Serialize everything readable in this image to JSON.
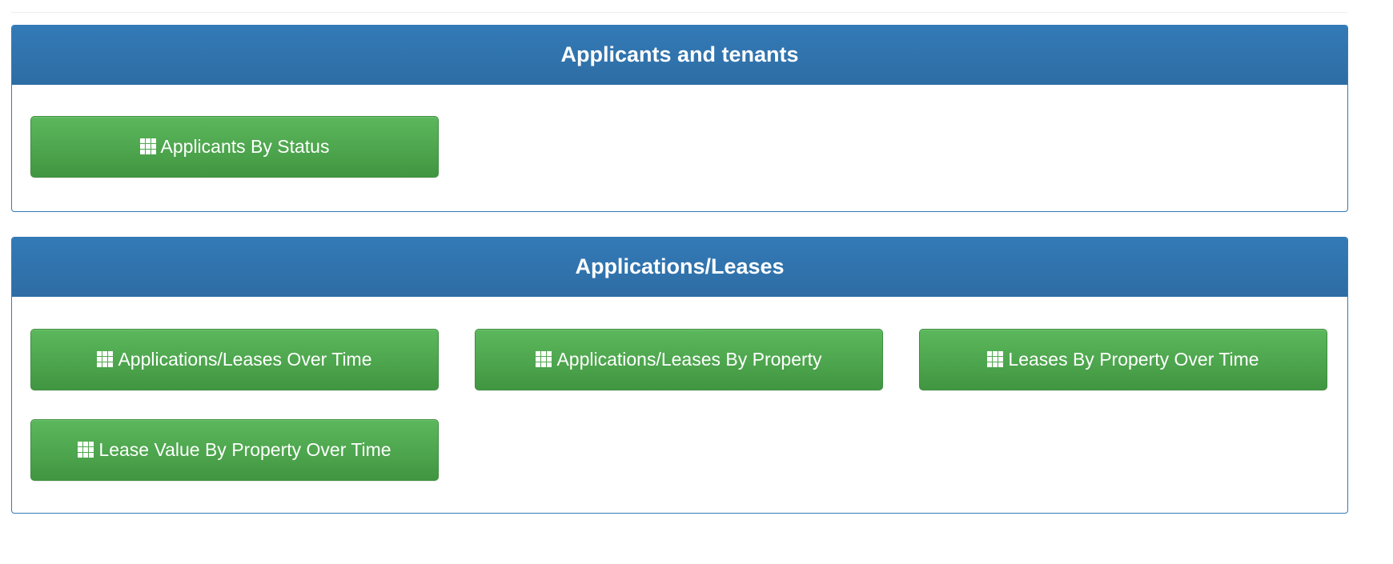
{
  "sections": [
    {
      "title": "Applicants and tenants",
      "buttons": [
        {
          "label": "Applicants By Status",
          "icon": "grid-icon"
        }
      ]
    },
    {
      "title": "Applications/Leases",
      "buttons": [
        {
          "label": "Applications/Leases Over Time",
          "icon": "grid-icon"
        },
        {
          "label": "Applications/Leases By Property",
          "icon": "grid-icon"
        },
        {
          "label": "Leases By Property Over Time",
          "icon": "grid-icon"
        },
        {
          "label": "Lease Value By Property Over Time",
          "icon": "grid-icon"
        }
      ]
    }
  ],
  "colors": {
    "panel_header": "#337ab7",
    "panel_border": "#337ab7",
    "button_green_top": "#5cb85c",
    "button_green_bottom": "#419641",
    "text_on_color": "#ffffff"
  }
}
